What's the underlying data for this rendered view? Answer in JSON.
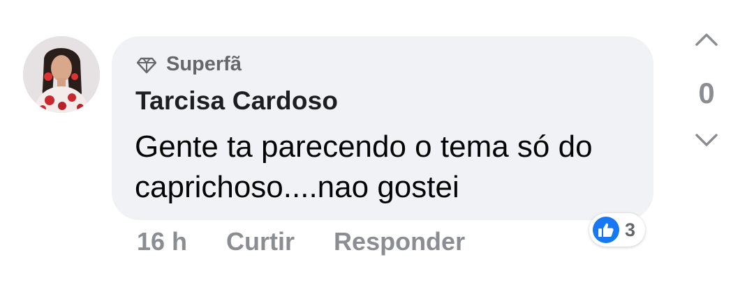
{
  "comment": {
    "badge": "Superfã",
    "author": "Tarcisa Cardoso",
    "text": "Gente ta parecendo o tema só do caprichoso....nao gostei",
    "time": "16 h",
    "like_label": "Curtir",
    "reply_label": "Responder",
    "reaction_count": "3",
    "reaction_icon": "thumbs-up-icon",
    "badge_icon": "diamond-icon"
  },
  "vote": {
    "score": "0",
    "up_icon": "chevron-up-icon",
    "down_icon": "chevron-down-icon"
  },
  "colors": {
    "bubble": "#f0f2f5",
    "accent": "#1877f2",
    "muted": "#8a8d91"
  }
}
